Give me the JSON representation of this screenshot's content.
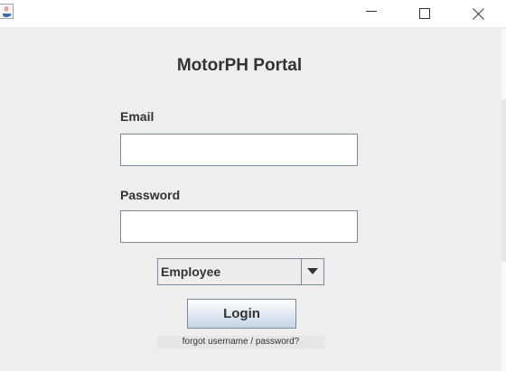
{
  "window": {
    "app_icon": "java-icon",
    "controls": {
      "minimize": "minimize-icon",
      "maximize": "maximize-icon",
      "close": "close-icon"
    }
  },
  "portal": {
    "title": "MotorPH Portal"
  },
  "form": {
    "email_label": "Email",
    "email_value": "",
    "password_label": "Password",
    "password_value": "",
    "role": {
      "selected": "Employee",
      "arrow_icon": "dropdown-arrow-icon"
    },
    "login_label": "Login",
    "forgot_text": "forgot username / password?"
  },
  "colors": {
    "background": "#eeeeee",
    "titlebar": "#ffffff",
    "text": "#333333",
    "border": "#7a8a99",
    "button_gradient_end": "#c7d5e6"
  }
}
